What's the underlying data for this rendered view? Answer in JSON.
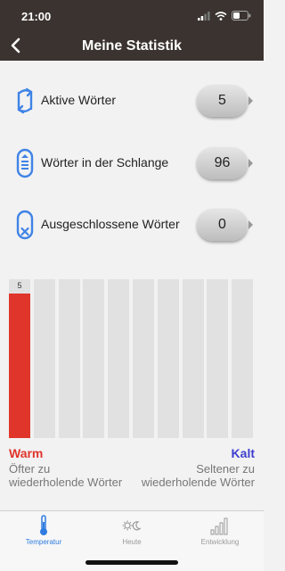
{
  "status": {
    "time": "21:00"
  },
  "nav": {
    "title": "Meine Statistik"
  },
  "stats": [
    {
      "label": "Aktive Wörter",
      "value": "5",
      "icon": "cycle-arrows-icon"
    },
    {
      "label": "Wörter in der Schlange",
      "value": "96",
      "icon": "queue-icon"
    },
    {
      "label": "Ausgeschlossene Wörter",
      "value": "0",
      "icon": "excluded-icon"
    }
  ],
  "chart_data": {
    "type": "bar",
    "values": [
      5,
      0,
      0,
      0,
      0,
      0,
      0,
      0,
      0,
      0
    ],
    "value_labels": [
      "5"
    ],
    "fill_fraction": [
      0.91,
      0,
      0,
      0,
      0,
      0,
      0,
      0,
      0,
      0
    ],
    "colors": {
      "filled": "#e0352b",
      "empty": "#e1e1e1"
    }
  },
  "legend": {
    "warm_title": "Warm",
    "warm_desc": "Öfter zu wiederholende Wörter",
    "cold_title": "Kalt",
    "cold_desc": "Seltener zu wiederholende Wörter"
  },
  "tabs": [
    {
      "label": "Temperatur",
      "icon": "thermometer-icon",
      "active": true
    },
    {
      "label": "Heute",
      "icon": "sun-moon-icon",
      "active": false
    },
    {
      "label": "Entwicklung",
      "icon": "signal-bars-icon",
      "active": false
    }
  ],
  "colors": {
    "accent": "#2f7ce0",
    "warm": "#e0352b",
    "cold": "#3f3fcf",
    "header": "#3a332f"
  }
}
